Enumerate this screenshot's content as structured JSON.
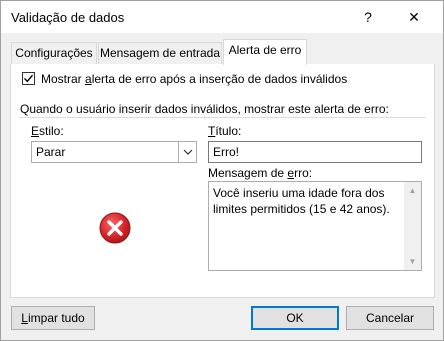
{
  "window": {
    "title": "Validação de dados",
    "help_glyph": "?",
    "close_glyph": "✕"
  },
  "tabs": [
    {
      "label": "Configurações",
      "active": false
    },
    {
      "label": "Mensagem de entrada",
      "active": false
    },
    {
      "label": "Alerta de erro",
      "active": true
    }
  ],
  "alert": {
    "show_checkbox": {
      "checked": true,
      "label_pre": "Mostrar ",
      "label_access": "a",
      "label_post": "lerta de erro após a inserção de dados inválidos"
    },
    "section_heading": "Quando o usuário inserir dados inválidos, mostrar este alerta de erro:",
    "style": {
      "label_access": "E",
      "label_rest": "stilo:",
      "value": "Parar",
      "icon": "error-stop-icon"
    },
    "title_field": {
      "label_access": "T",
      "label_rest": "ítulo:",
      "value": "Erro!"
    },
    "message_field": {
      "label_pre": "Mensagem de ",
      "label_access": "e",
      "label_post": "rro:",
      "value": "Você inseriu uma idade fora dos limites permitidos (15 e 42 anos)."
    }
  },
  "buttons": {
    "clear_access": "L",
    "clear_rest": "impar tudo",
    "ok": "OK",
    "cancel": "Cancelar"
  },
  "colors": {
    "error_red": "#d9262a",
    "default_button_border": "#0078d7"
  }
}
